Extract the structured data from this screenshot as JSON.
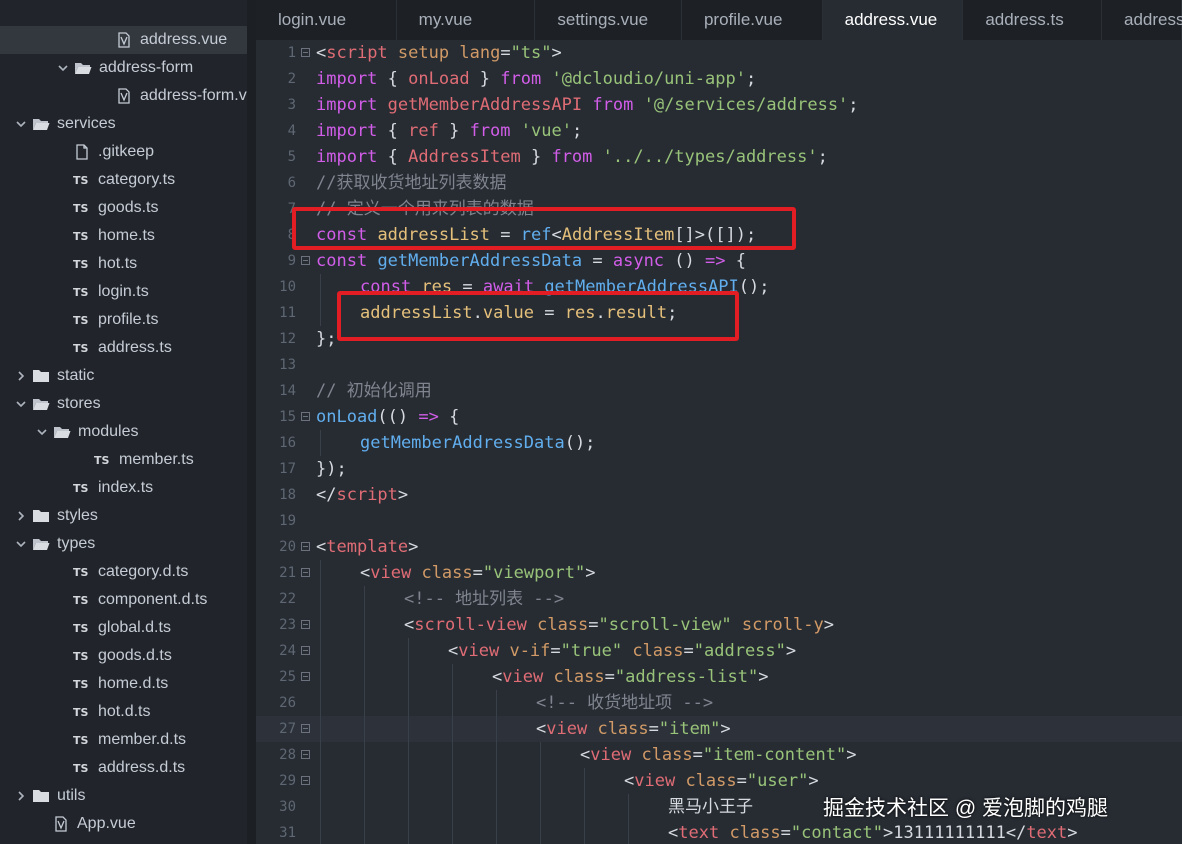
{
  "sidebar": {
    "items": [
      {
        "label": "address.vue",
        "type": "vue",
        "indent": 3,
        "selected": true
      },
      {
        "label": "address-form",
        "type": "folder-open",
        "indent": 2
      },
      {
        "label": "address-form.vue",
        "type": "vue",
        "indent": 3
      },
      {
        "label": "services",
        "type": "folder-open",
        "indent": 0
      },
      {
        "label": ".gitkeep",
        "type": "file",
        "indent": 1
      },
      {
        "label": "category.ts",
        "type": "ts",
        "indent": 1
      },
      {
        "label": "goods.ts",
        "type": "ts",
        "indent": 1
      },
      {
        "label": "home.ts",
        "type": "ts",
        "indent": 1
      },
      {
        "label": "hot.ts",
        "type": "ts",
        "indent": 1
      },
      {
        "label": "login.ts",
        "type": "ts",
        "indent": 1
      },
      {
        "label": "profile.ts",
        "type": "ts",
        "indent": 1
      },
      {
        "label": "address.ts",
        "type": "ts",
        "indent": 1
      },
      {
        "label": "static",
        "type": "folder-closed",
        "indent": 0
      },
      {
        "label": "stores",
        "type": "folder-open",
        "indent": 0
      },
      {
        "label": "modules",
        "type": "folder-open",
        "indent": 1
      },
      {
        "label": "member.ts",
        "type": "ts",
        "indent": 2
      },
      {
        "label": "index.ts",
        "type": "ts",
        "indent": 1
      },
      {
        "label": "styles",
        "type": "folder-closed",
        "indent": 0
      },
      {
        "label": "types",
        "type": "folder-open",
        "indent": 0
      },
      {
        "label": "category.d.ts",
        "type": "ts",
        "indent": 1
      },
      {
        "label": "component.d.ts",
        "type": "ts",
        "indent": 1
      },
      {
        "label": "global.d.ts",
        "type": "ts",
        "indent": 1
      },
      {
        "label": "goods.d.ts",
        "type": "ts",
        "indent": 1
      },
      {
        "label": "home.d.ts",
        "type": "ts",
        "indent": 1
      },
      {
        "label": "hot.d.ts",
        "type": "ts",
        "indent": 1
      },
      {
        "label": "member.d.ts",
        "type": "ts",
        "indent": 1
      },
      {
        "label": "address.d.ts",
        "type": "ts",
        "indent": 1
      },
      {
        "label": "utils",
        "type": "folder-closed",
        "indent": 0
      },
      {
        "label": "App.vue",
        "type": "vue",
        "indent": 0
      }
    ],
    "ts_badge": "TS"
  },
  "tabs": [
    {
      "label": "login.vue",
      "active": false
    },
    {
      "label": "my.vue",
      "active": false
    },
    {
      "label": "settings.vue",
      "active": false
    },
    {
      "label": "profile.vue",
      "active": false
    },
    {
      "label": "address.vue",
      "active": true
    },
    {
      "label": "address.ts",
      "active": false
    },
    {
      "label": "address.",
      "active": false
    }
  ],
  "editor": {
    "current_line": 27,
    "lines": [
      {
        "n": "1",
        "fold": true,
        "indent": 0,
        "tokens": [
          [
            "p",
            "<"
          ],
          [
            "t",
            "script"
          ],
          [
            "p",
            " "
          ],
          [
            "attr",
            "setup"
          ],
          [
            "p",
            " "
          ],
          [
            "attr",
            "lang"
          ],
          [
            "p",
            "="
          ],
          [
            "s",
            "\"ts\""
          ],
          [
            "p",
            ">"
          ]
        ]
      },
      {
        "n": "2",
        "indent": 0,
        "tokens": [
          [
            "k",
            "import"
          ],
          [
            "p",
            " { "
          ],
          [
            "v",
            "onLoad"
          ],
          [
            "p",
            " } "
          ],
          [
            "k",
            "from"
          ],
          [
            "p",
            " "
          ],
          [
            "s",
            "'@dcloudio/uni-app'"
          ],
          [
            "p",
            ";"
          ]
        ]
      },
      {
        "n": "3",
        "indent": 0,
        "tokens": [
          [
            "k",
            "import"
          ],
          [
            "p",
            " "
          ],
          [
            "v",
            "getMemberAddressAPI"
          ],
          [
            "p",
            " "
          ],
          [
            "k",
            "from"
          ],
          [
            "p",
            " "
          ],
          [
            "s",
            "'@/services/address'"
          ],
          [
            "p",
            ";"
          ]
        ]
      },
      {
        "n": "4",
        "indent": 0,
        "tokens": [
          [
            "k",
            "import"
          ],
          [
            "p",
            " { "
          ],
          [
            "v",
            "ref"
          ],
          [
            "p",
            " } "
          ],
          [
            "k",
            "from"
          ],
          [
            "p",
            " "
          ],
          [
            "s",
            "'vue'"
          ],
          [
            "p",
            ";"
          ]
        ]
      },
      {
        "n": "5",
        "indent": 0,
        "tokens": [
          [
            "k",
            "import"
          ],
          [
            "p",
            " { "
          ],
          [
            "v",
            "AddressItem"
          ],
          [
            "p",
            " } "
          ],
          [
            "k",
            "from"
          ],
          [
            "p",
            " "
          ],
          [
            "s",
            "'../../types/address'"
          ],
          [
            "p",
            ";"
          ]
        ]
      },
      {
        "n": "6",
        "indent": 0,
        "tokens": [
          [
            "c",
            "//获取收货地址列表数据"
          ]
        ]
      },
      {
        "n": "7",
        "indent": 0,
        "tokens": [
          [
            "c",
            "// 定义一个用来列表的数据"
          ]
        ]
      },
      {
        "n": "8",
        "indent": 0,
        "tokens": [
          [
            "k",
            "const"
          ],
          [
            "p",
            " "
          ],
          [
            "a",
            "addressList"
          ],
          [
            "p",
            " = "
          ],
          [
            "f",
            "ref"
          ],
          [
            "p",
            "<"
          ],
          [
            "a",
            "AddressItem"
          ],
          [
            "p",
            "[]>([]);"
          ]
        ]
      },
      {
        "n": "9",
        "fold": true,
        "indent": 0,
        "tokens": [
          [
            "k",
            "const"
          ],
          [
            "p",
            " "
          ],
          [
            "f",
            "getMemberAddressData"
          ],
          [
            "p",
            " = "
          ],
          [
            "k",
            "async"
          ],
          [
            "p",
            " () "
          ],
          [
            "k",
            "=>"
          ],
          [
            "p",
            " {"
          ]
        ]
      },
      {
        "n": "10",
        "indent": 1,
        "tokens": [
          [
            "k",
            "const"
          ],
          [
            "p",
            " "
          ],
          [
            "a",
            "res"
          ],
          [
            "p",
            " = "
          ],
          [
            "k",
            "await"
          ],
          [
            "p",
            " "
          ],
          [
            "f",
            "getMemberAddressAPI"
          ],
          [
            "p",
            "();"
          ]
        ]
      },
      {
        "n": "11",
        "indent": 1,
        "tokens": [
          [
            "a",
            "addressList"
          ],
          [
            "p",
            "."
          ],
          [
            "a",
            "value"
          ],
          [
            "p",
            " = "
          ],
          [
            "a",
            "res"
          ],
          [
            "p",
            "."
          ],
          [
            "a",
            "result"
          ],
          [
            "p",
            ";"
          ]
        ]
      },
      {
        "n": "12",
        "indent": 0,
        "tokens": [
          [
            "p",
            "};"
          ]
        ]
      },
      {
        "n": "13",
        "indent": 0,
        "tokens": []
      },
      {
        "n": "14",
        "indent": 0,
        "tokens": [
          [
            "c",
            "// 初始化调用"
          ]
        ]
      },
      {
        "n": "15",
        "fold": true,
        "indent": 0,
        "tokens": [
          [
            "f",
            "onLoad"
          ],
          [
            "p",
            "(() "
          ],
          [
            "k",
            "=>"
          ],
          [
            "p",
            " {"
          ]
        ]
      },
      {
        "n": "16",
        "indent": 1,
        "tokens": [
          [
            "f",
            "getMemberAddressData"
          ],
          [
            "p",
            "();"
          ]
        ]
      },
      {
        "n": "17",
        "indent": 0,
        "tokens": [
          [
            "p",
            "});"
          ]
        ]
      },
      {
        "n": "18",
        "indent": 0,
        "tokens": [
          [
            "p",
            "</"
          ],
          [
            "t",
            "script"
          ],
          [
            "p",
            ">"
          ]
        ]
      },
      {
        "n": "19",
        "indent": 0,
        "tokens": []
      },
      {
        "n": "20",
        "fold": true,
        "indent": 0,
        "tokens": [
          [
            "p",
            "<"
          ],
          [
            "t",
            "template"
          ],
          [
            "p",
            ">"
          ]
        ]
      },
      {
        "n": "21",
        "fold": true,
        "indent": 1,
        "tokens": [
          [
            "p",
            "<"
          ],
          [
            "t",
            "view"
          ],
          [
            "p",
            " "
          ],
          [
            "attr",
            "class"
          ],
          [
            "p",
            "="
          ],
          [
            "s",
            "\"viewport\""
          ],
          [
            "p",
            ">"
          ]
        ]
      },
      {
        "n": "22",
        "indent": 2,
        "tokens": [
          [
            "c",
            "<!-- 地址列表 -->"
          ]
        ]
      },
      {
        "n": "23",
        "fold": true,
        "indent": 2,
        "tokens": [
          [
            "p",
            "<"
          ],
          [
            "t",
            "scroll-view"
          ],
          [
            "p",
            " "
          ],
          [
            "attr",
            "class"
          ],
          [
            "p",
            "="
          ],
          [
            "s",
            "\"scroll-view\""
          ],
          [
            "p",
            " "
          ],
          [
            "attr",
            "scroll-y"
          ],
          [
            "p",
            ">"
          ]
        ]
      },
      {
        "n": "24",
        "fold": true,
        "indent": 3,
        "tokens": [
          [
            "p",
            "<"
          ],
          [
            "t",
            "view"
          ],
          [
            "p",
            " "
          ],
          [
            "attr",
            "v-if"
          ],
          [
            "p",
            "="
          ],
          [
            "s",
            "\"true\""
          ],
          [
            "p",
            " "
          ],
          [
            "attr",
            "class"
          ],
          [
            "p",
            "="
          ],
          [
            "s",
            "\"address\""
          ],
          [
            "p",
            ">"
          ]
        ]
      },
      {
        "n": "25",
        "fold": true,
        "indent": 4,
        "tokens": [
          [
            "p",
            "<"
          ],
          [
            "t",
            "view"
          ],
          [
            "p",
            " "
          ],
          [
            "attr",
            "class"
          ],
          [
            "p",
            "="
          ],
          [
            "s",
            "\"address-list\""
          ],
          [
            "p",
            ">"
          ]
        ]
      },
      {
        "n": "26",
        "indent": 5,
        "tokens": [
          [
            "c",
            "<!-- 收货地址项 -->"
          ]
        ]
      },
      {
        "n": "27",
        "fold": true,
        "indent": 5,
        "tokens": [
          [
            "p",
            "<"
          ],
          [
            "t",
            "view"
          ],
          [
            "p",
            " "
          ],
          [
            "attr",
            "class"
          ],
          [
            "p",
            "="
          ],
          [
            "s",
            "\"item\""
          ],
          [
            "p",
            ">"
          ]
        ]
      },
      {
        "n": "28",
        "fold": true,
        "indent": 6,
        "tokens": [
          [
            "p",
            "<"
          ],
          [
            "t",
            "view"
          ],
          [
            "p",
            " "
          ],
          [
            "attr",
            "class"
          ],
          [
            "p",
            "="
          ],
          [
            "s",
            "\"item-content\""
          ],
          [
            "p",
            ">"
          ]
        ]
      },
      {
        "n": "29",
        "fold": true,
        "indent": 7,
        "tokens": [
          [
            "p",
            "<"
          ],
          [
            "t",
            "view"
          ],
          [
            "p",
            " "
          ],
          [
            "attr",
            "class"
          ],
          [
            "p",
            "="
          ],
          [
            "s",
            "\"user\""
          ],
          [
            "p",
            ">"
          ]
        ]
      },
      {
        "n": "30",
        "indent": 8,
        "tokens": [
          [
            "p",
            "黑马小王子"
          ]
        ]
      },
      {
        "n": "31",
        "indent": 8,
        "tokens": [
          [
            "p",
            "<"
          ],
          [
            "t",
            "text"
          ],
          [
            "p",
            " "
          ],
          [
            "attr",
            "class"
          ],
          [
            "p",
            "="
          ],
          [
            "s",
            "\"contact\""
          ],
          [
            "p",
            ">13111111111</"
          ],
          [
            "t",
            "text"
          ],
          [
            "p",
            ">"
          ]
        ]
      }
    ]
  },
  "watermark": "掘金技术社区 @ 爱泡脚的鸡腿"
}
